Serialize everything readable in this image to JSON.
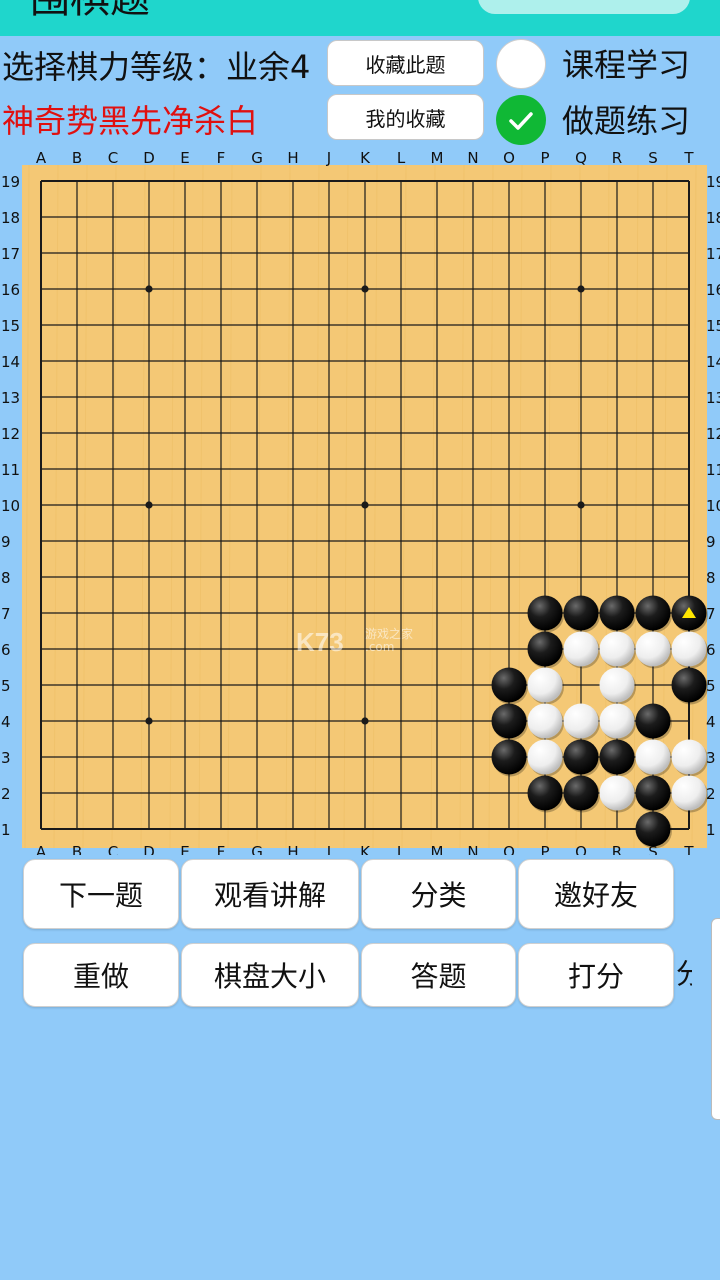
{
  "header": {
    "cut_title": "围棋题",
    "level_label": "选择棋力等级：业余4",
    "problem_title": "神奇势黑先净杀白",
    "bookmark_label": "收藏此题",
    "my_bookmarks_label": "我的收藏",
    "course_mode_label": "课程学习",
    "practice_mode_label": "做题练习",
    "selected_mode": "做题练习"
  },
  "board": {
    "size": 19,
    "columns": [
      "A",
      "B",
      "C",
      "D",
      "E",
      "F",
      "G",
      "H",
      "J",
      "K",
      "L",
      "M",
      "N",
      "O",
      "P",
      "Q",
      "R",
      "S",
      "T"
    ],
    "rows": [
      "19",
      "18",
      "17",
      "16",
      "15",
      "14",
      "13",
      "12",
      "11",
      "10",
      "9",
      "8",
      "7",
      "6",
      "5",
      "4",
      "3",
      "2",
      "1"
    ],
    "watermark_brand": "K73",
    "watermark_site": "游戏之家",
    "watermark_domain": ".com",
    "stones": [
      {
        "point": "P7",
        "color": "black"
      },
      {
        "point": "Q7",
        "color": "black"
      },
      {
        "point": "R7",
        "color": "black"
      },
      {
        "point": "S7",
        "color": "black"
      },
      {
        "point": "T7",
        "color": "black",
        "last_move": true
      },
      {
        "point": "P6",
        "color": "black"
      },
      {
        "point": "Q6",
        "color": "white"
      },
      {
        "point": "R6",
        "color": "white"
      },
      {
        "point": "S6",
        "color": "white"
      },
      {
        "point": "T6",
        "color": "white"
      },
      {
        "point": "O5",
        "color": "black"
      },
      {
        "point": "P5",
        "color": "white"
      },
      {
        "point": "R5",
        "color": "white"
      },
      {
        "point": "T5",
        "color": "black"
      },
      {
        "point": "O4",
        "color": "black"
      },
      {
        "point": "P4",
        "color": "white"
      },
      {
        "point": "Q4",
        "color": "white"
      },
      {
        "point": "R4",
        "color": "white"
      },
      {
        "point": "S4",
        "color": "black"
      },
      {
        "point": "O3",
        "color": "black"
      },
      {
        "point": "P3",
        "color": "white"
      },
      {
        "point": "Q3",
        "color": "black"
      },
      {
        "point": "R3",
        "color": "black"
      },
      {
        "point": "S3",
        "color": "white"
      },
      {
        "point": "T3",
        "color": "white"
      },
      {
        "point": "P2",
        "color": "black"
      },
      {
        "point": "Q2",
        "color": "black"
      },
      {
        "point": "R2",
        "color": "white"
      },
      {
        "point": "S2",
        "color": "black"
      },
      {
        "point": "T2",
        "color": "white"
      },
      {
        "point": "S1",
        "color": "black"
      }
    ],
    "colors": {
      "board_wood": "#f4c875",
      "board_wood_dark": "#e9b85a",
      "grid_line": "#1a1a1a",
      "last_move_marker": "#ffe600"
    }
  },
  "controls": {
    "next_problem": "下一题",
    "watch_explanation": "观看讲解",
    "category": "分类",
    "invite_friends": "邀好友",
    "redo": "重做",
    "board_size": "棋盘大小",
    "answer": "答题",
    "rate": "打分"
  },
  "side_fragment": "分",
  "icons": {
    "practice_toggle": "checkmark-icon",
    "course_toggle": "radio-unselected-icon",
    "last_move": "triangle-marker-icon"
  }
}
